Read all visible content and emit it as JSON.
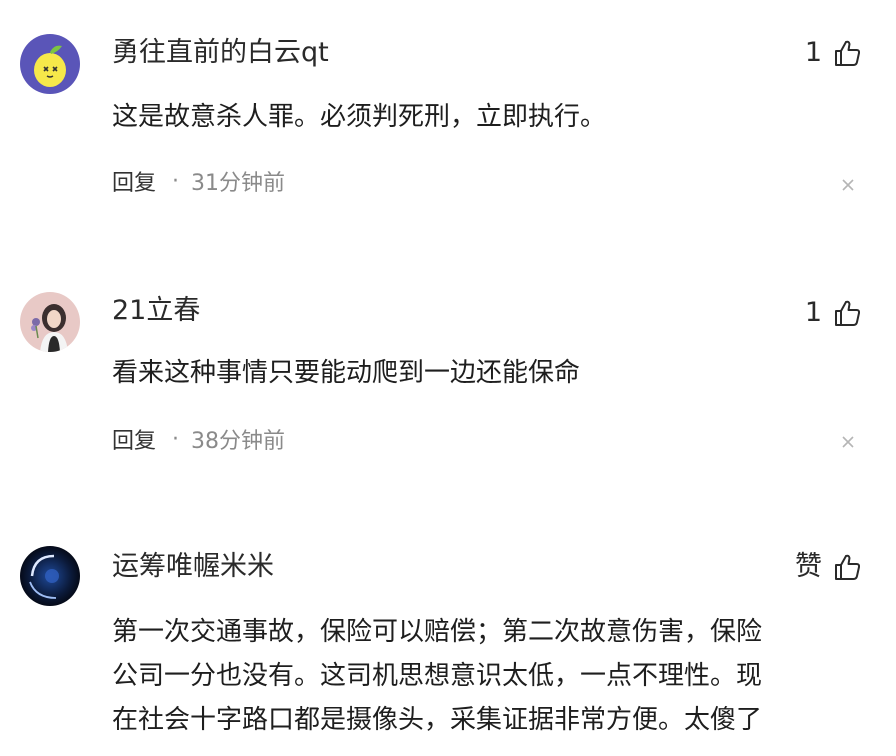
{
  "comments": [
    {
      "username": "勇往直前的白云qt",
      "like_count": "1",
      "content": "这是故意杀人罪。必须判死刑，立即执行。",
      "reply_label": "回复",
      "separator": "·",
      "time": "31分钟前",
      "avatar": "lemon-avatar"
    },
    {
      "username": "21立春",
      "like_count": "1",
      "content": "看来这种事情只要能动爬到一边还能保命",
      "reply_label": "回复",
      "separator": "·",
      "time": "38分钟前",
      "avatar": "girl-avatar"
    },
    {
      "username": "运筹唯幄米米",
      "like_count": "赞",
      "content_lines": [
        "第一次交通事故，保险可以赔偿；第二次故意伤害，保险",
        "公司一分也没有。这司机思想意识太低，一点不理性。现",
        "在社会十字路口都是摄像头，采集证据非常方便。太傻了"
      ],
      "avatar": "night-avatar"
    }
  ],
  "icons": {
    "like": "thumbs-up-icon",
    "close": "close-icon"
  },
  "colors": {
    "text": "#222222",
    "meta": "#8a8a8a",
    "background": "#ffffff"
  }
}
